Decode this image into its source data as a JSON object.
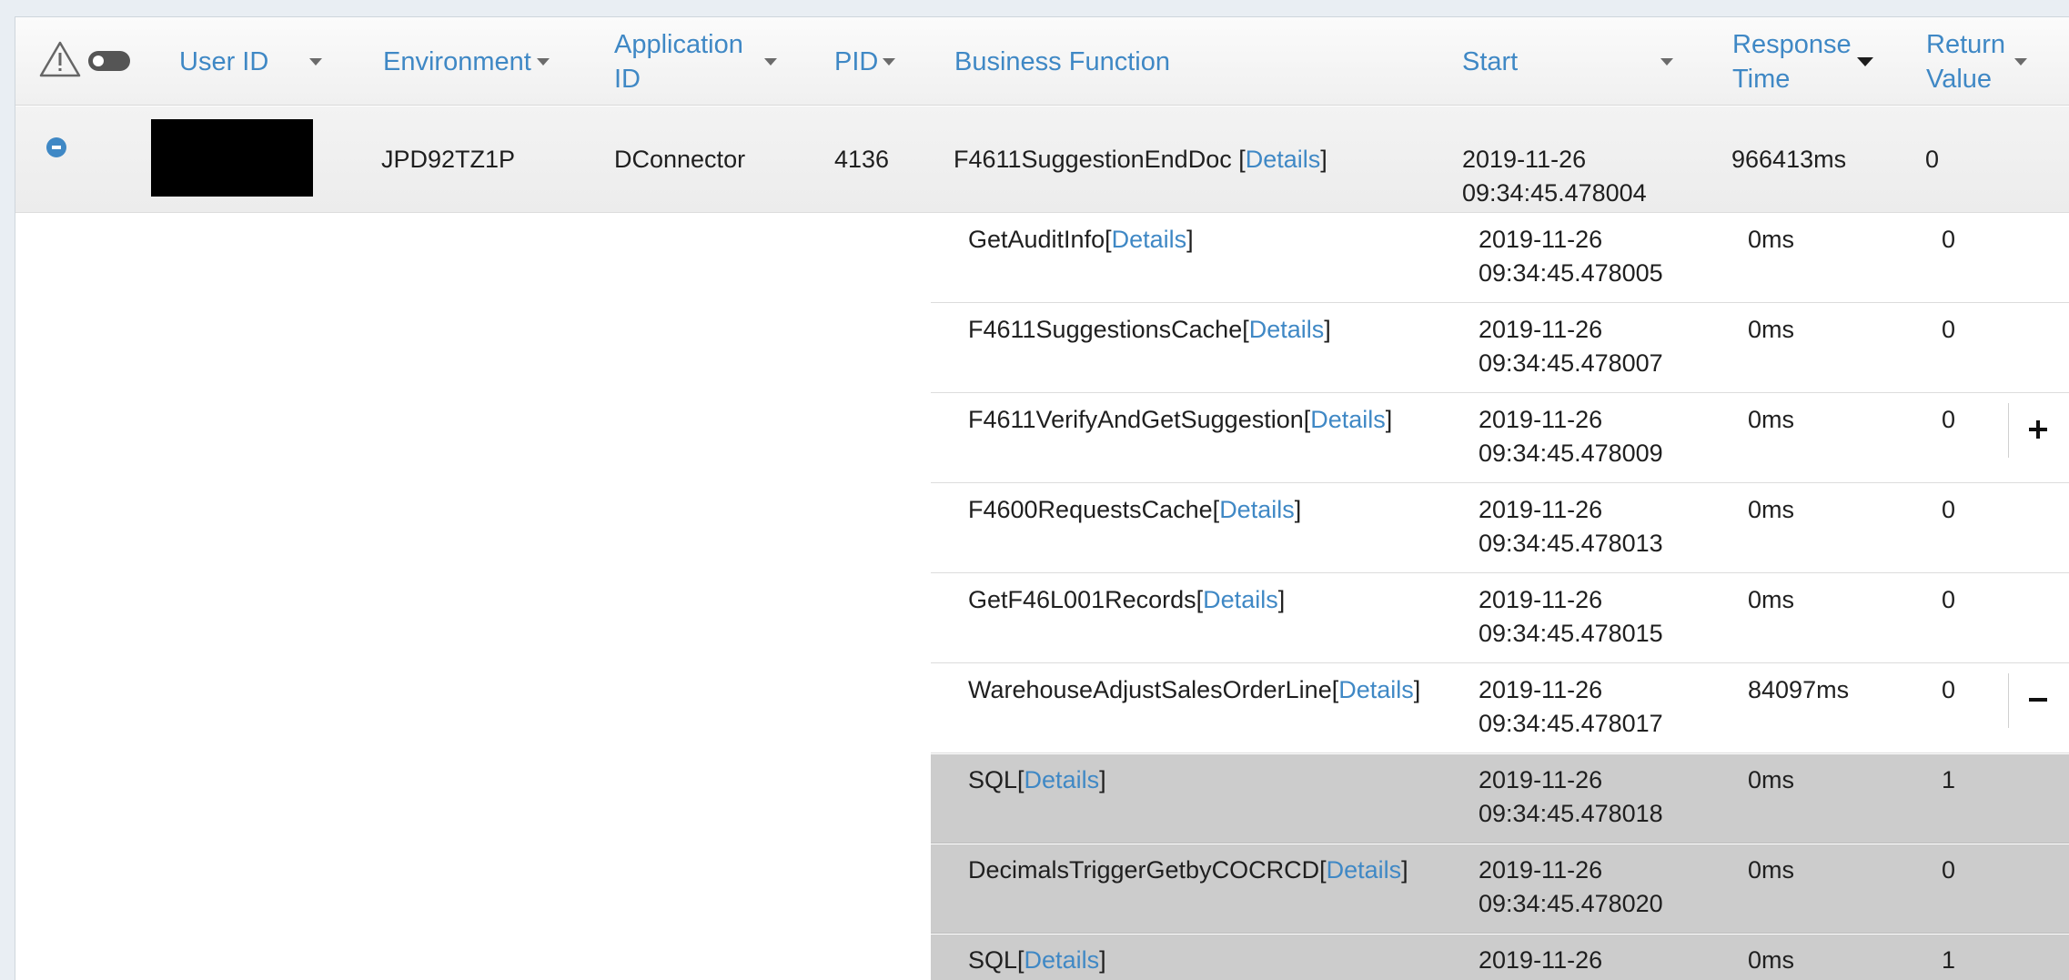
{
  "header": {
    "user_id": "User ID",
    "environment": "Environment",
    "application_id_line1": "Application",
    "application_id_line2": "ID",
    "pid": "PID",
    "business_function": "Business Function",
    "start": "Start",
    "response_time_line1": "Response",
    "response_time_line2": "Time",
    "return_value_line1": "Return",
    "return_value_line2": "Value"
  },
  "icons": {
    "warning": "warning-icon",
    "toggle": "toggle-icon",
    "collapse": "collapse-icon",
    "expand": "plus-icon",
    "collapse_row": "minus-icon"
  },
  "colors": {
    "link": "#3f88c5",
    "grey_row": "#cccccc",
    "redaction": "#000000"
  },
  "main_row": {
    "environment": "JPD92TZ1P",
    "application_id": "DConnector",
    "pid": "4136",
    "business_function": "F4611SuggestionEndDoc ",
    "details_open": "[",
    "details_label": "Details",
    "details_close": "]",
    "start_date": "2019-11-26",
    "start_time": "09:34:45.478004",
    "response_time": "966413ms",
    "return_value": "0"
  },
  "rows": [
    {
      "name": "GetAuditInfo",
      "date": "2019-11-26",
      "time": "09:34:45.478005",
      "response": "0ms",
      "return": "0"
    },
    {
      "name": "F4611SuggestionsCache",
      "date": "2019-11-26",
      "time": "09:34:45.478007",
      "response": "0ms",
      "return": "0"
    },
    {
      "name": "F4611VerifyAndGetSuggestion",
      "date": "2019-11-26",
      "time": "09:34:45.478009",
      "response": "0ms",
      "return": "0"
    },
    {
      "name": "F4600RequestsCache",
      "date": "2019-11-26",
      "time": "09:34:45.478013",
      "response": "0ms",
      "return": "0"
    },
    {
      "name": "GetF46L001Records",
      "date": "2019-11-26",
      "time": "09:34:45.478015",
      "response": "0ms",
      "return": "0"
    },
    {
      "name": "WarehouseAdjustSalesOrderLine",
      "date": "2019-11-26",
      "time": "09:34:45.478017",
      "response": "84097ms",
      "return": "0"
    },
    {
      "name": "SQL",
      "date": "2019-11-26",
      "time": "09:34:45.478018",
      "response": "0ms",
      "return": "1"
    },
    {
      "name": "DecimalsTriggerGetbyCOCRCD",
      "date": "2019-11-26",
      "time": "09:34:45.478020",
      "response": "0ms",
      "return": "0"
    },
    {
      "name": "SQL",
      "date": "2019-11-26",
      "time": "",
      "response": "0ms",
      "return": "1"
    }
  ],
  "details": {
    "open": "[",
    "label": "Details",
    "close": "]"
  }
}
